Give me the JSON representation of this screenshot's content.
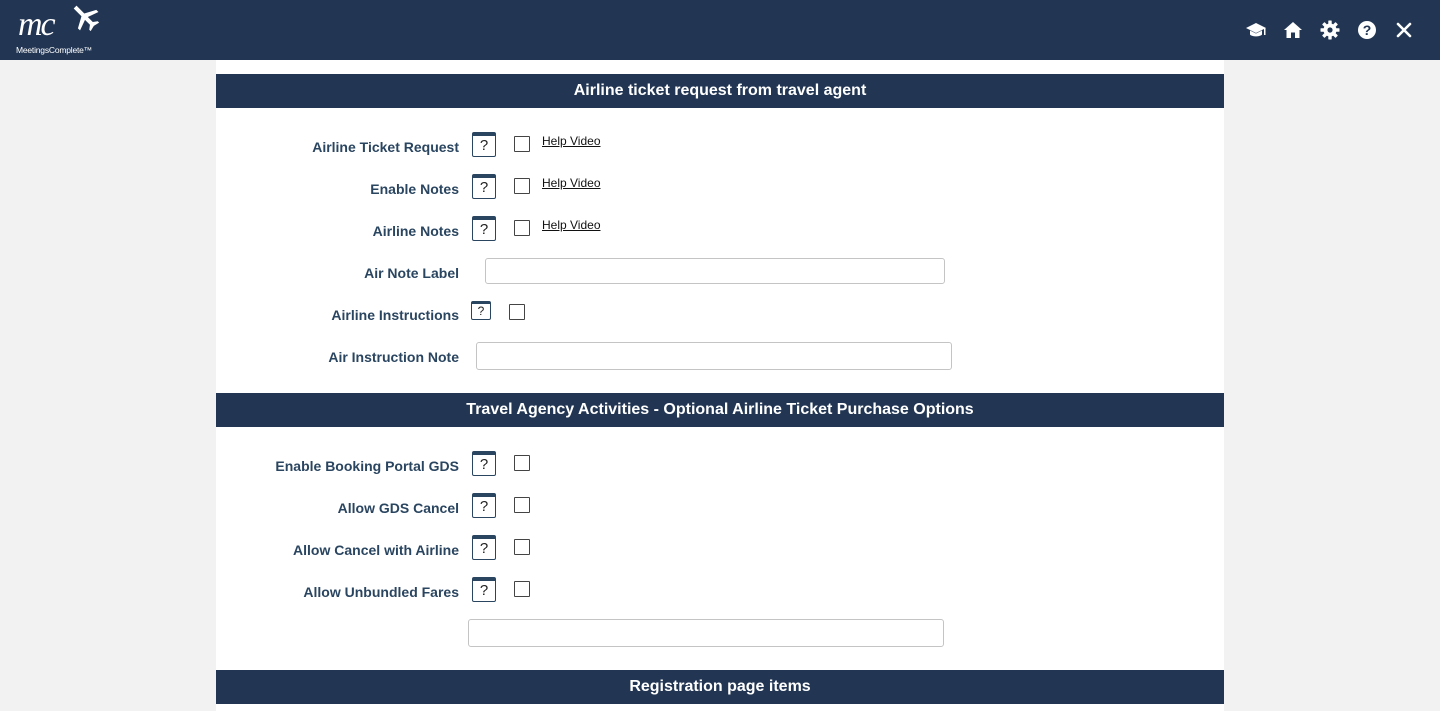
{
  "header": {
    "logo_text": "mc",
    "logo_subtext": "MeetingsComplete™",
    "icons": [
      "graduation-cap-icon",
      "home-icon",
      "gear-icon",
      "help-circle-icon",
      "close-icon"
    ],
    "background_color": "#223654"
  },
  "sections": [
    {
      "title": "Airline ticket request from travel agent",
      "rows": [
        {
          "label": "Airline Ticket Request",
          "help_icon": "?",
          "checked": false,
          "link": "Help Video"
        },
        {
          "label": "Enable Notes",
          "help_icon": "?",
          "checked": false,
          "link": "Help Video"
        },
        {
          "label": "Airline Notes",
          "help_icon": "?",
          "checked": false,
          "link": "Help Video"
        },
        {
          "label": "Air Note Label",
          "input_value": ""
        },
        {
          "label": "Airline Instructions",
          "help_icon": "?",
          "checked": false
        },
        {
          "label": "Air Instruction Note",
          "input_value": ""
        }
      ]
    },
    {
      "title": "Travel Agency Activities - Optional Airline Ticket Purchase Options",
      "rows": [
        {
          "label": "Enable Booking Portal GDS",
          "help_icon": "?",
          "checked": false
        },
        {
          "label": "Allow GDS Cancel",
          "help_icon": "?",
          "checked": false
        },
        {
          "label": "Allow Cancel with Airline",
          "help_icon": "?",
          "checked": false
        },
        {
          "label": "Allow Unbundled Fares",
          "help_icon": "?",
          "checked": false
        },
        {
          "input_value": ""
        }
      ]
    },
    {
      "title": "Registration page items"
    }
  ]
}
